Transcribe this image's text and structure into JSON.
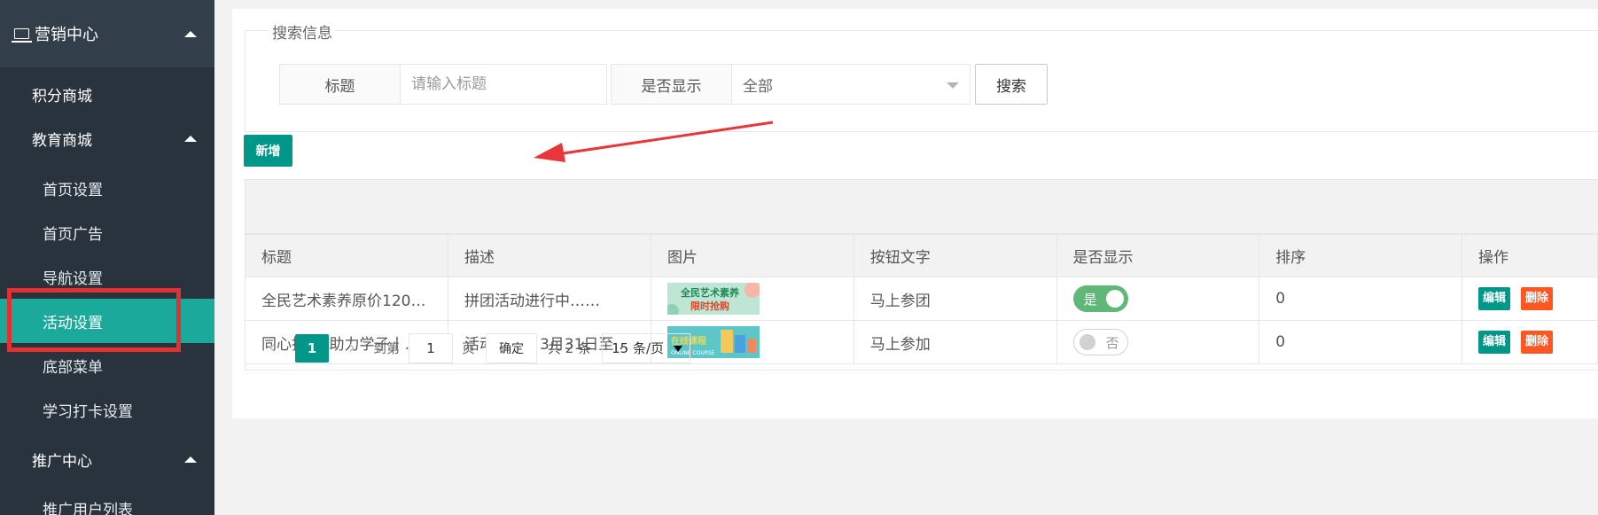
{
  "sidebar": {
    "header": "营销中心",
    "items": [
      {
        "label": "积分商城"
      },
      {
        "label": "教育商城"
      },
      {
        "label": "首页设置"
      },
      {
        "label": "首页广告"
      },
      {
        "label": "导航设置"
      },
      {
        "label": "活动设置"
      },
      {
        "label": "底部菜单"
      },
      {
        "label": "学习打卡设置"
      },
      {
        "label": "推广中心"
      },
      {
        "label": "推广用户列表"
      }
    ]
  },
  "search": {
    "legend": "搜索信息",
    "title_label": "标题",
    "title_placeholder": "请输入标题",
    "show_label": "是否显示",
    "show_value": "全部",
    "button": "搜索"
  },
  "add_button": "新增",
  "table": {
    "columns": [
      "标题",
      "描述",
      "图片",
      "按钮文字",
      "是否显示",
      "排序",
      "操作"
    ],
    "rows": [
      {
        "title": "全民艺术素养原价120…",
        "desc": "拼团活动进行中……",
        "image_text": [
          "全民艺术素养",
          "限时抢购"
        ],
        "button_text": "马上参团",
        "show": "是",
        "sort": "0"
      },
      {
        "title": "同心抗疫*助力学子丨…",
        "desc": "活动时间：3月31日至…",
        "image_text": [
          "在线课程",
          "ONLINE COURSE"
        ],
        "button_text": "马上参加",
        "show": "否",
        "sort": "0"
      }
    ],
    "edit": "编辑",
    "delete": "删除"
  },
  "pager": {
    "current": "1",
    "goto_label": "到第",
    "goto_value": "1",
    "page_unit": "页",
    "confirm": "确定",
    "total": "共 2 条",
    "page_size": "15 条/页"
  },
  "colors": {
    "sidebar_bg": "#28333e",
    "active": "#1ba99b",
    "primary": "#009688",
    "danger": "#ff5722",
    "switch_on": "#5fb878",
    "highlight": "#e5302f"
  }
}
